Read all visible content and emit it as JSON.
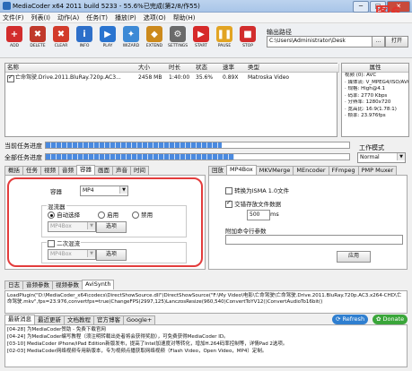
{
  "window": {
    "title": "MediaCoder x64 2011 build 5233 - 55.6%已完成(第2/8/作55)",
    "min": "─",
    "max": "□",
    "close": "✕"
  },
  "annotation": "图6",
  "menu": [
    "文件(F)",
    "列表(I)",
    "动作(A)",
    "任务(T)",
    "播放(P)",
    "选项(O)",
    "帮助(H)"
  ],
  "toolbar": {
    "buttons": [
      {
        "label": "ADD",
        "icon": "add-icon",
        "color": "#d22d2d",
        "glyph": "+"
      },
      {
        "label": "DELETE",
        "icon": "delete-icon",
        "color": "#c0392b",
        "glyph": "✖"
      },
      {
        "label": "CLEAR",
        "icon": "clear-icon",
        "color": "#d23b2b",
        "glyph": "✖"
      },
      {
        "label": "INFO",
        "icon": "info-icon",
        "color": "#2d6fc9",
        "glyph": "i"
      },
      {
        "label": "PLAY",
        "icon": "play-icon",
        "color": "#2a74d0",
        "glyph": "▶"
      },
      {
        "label": "WIZARD",
        "icon": "wizard-icon",
        "color": "#3d8ad6",
        "glyph": "✦"
      },
      {
        "label": "EXTEND",
        "icon": "extend-icon",
        "color": "#cc8a1d",
        "glyph": "◆"
      },
      {
        "label": "SETTINGS",
        "icon": "settings-icon",
        "color": "#6a6a6a",
        "glyph": "⚙"
      },
      {
        "label": "START",
        "icon": "start-icon",
        "color": "#d62a2a",
        "glyph": "▶"
      },
      {
        "label": "PAUSE",
        "icon": "pause-icon",
        "color": "#e2a423",
        "glyph": "❚❚"
      },
      {
        "label": "STOP",
        "icon": "stop-icon",
        "color": "#d22d2d",
        "glyph": "■"
      }
    ],
    "output_label": "输出路径",
    "output_path": "C:\\Users\\Administrator\\Desk",
    "browse": "...",
    "open": "打开"
  },
  "filelist": {
    "columns": [
      "名称",
      "大小",
      "时长",
      "状态",
      "速率",
      "类型"
    ],
    "rows": [
      {
        "name": "亡命驾驶.Drive.2011.BluRay.720p.AC3...",
        "size": "2458 MB",
        "duration": "1:40:00",
        "status": "35.6%",
        "rate": "0.89X",
        "type": "Matroska Video"
      }
    ]
  },
  "properties": {
    "header": "属性",
    "items": [
      "视频 (0): AVC",
      "· 媒体流: V_MPEG4/ISO/AVC",
      "· 规格: High@4.1",
      "· 码率: 2770 Kbps",
      "· 分辨率: 1280x720",
      "· 宽高比: 16:9(1.78:1)",
      "· 帧率: 23.976fps"
    ]
  },
  "progress": {
    "current_label": "当前任务进度",
    "total_label": "全部任务进度",
    "current": 0.58,
    "total": 0.62
  },
  "workmode": {
    "label": "工作模式",
    "value": "Normal"
  },
  "left_tabs": [
    "概括",
    "任务",
    "视频",
    "音频",
    "容器",
    "画面",
    "声音",
    "时间"
  ],
  "right_tabs": [
    "回放",
    "MP4Box",
    "MKVMerge",
    "MEncoder",
    "FFmpeg",
    "PMP Muxer"
  ],
  "container": {
    "label": "容器",
    "value": "MP4",
    "muxer_group": "混流器",
    "auto": "自动选择",
    "enable": "启用",
    "disable": "禁用",
    "muxer_value": "MP4Box",
    "muxer_btn": "选项",
    "second_pass": "二次混流",
    "second_value": "MP4Box",
    "second_btn": "选项"
  },
  "mp4box": {
    "ipsa": "转换为ISMA 1.0文件",
    "interleave": "交错存放文件数据",
    "interleave_value": "500",
    "interleave_unit": "ms",
    "extra_label": "附加命令行参数",
    "apply": "应用"
  },
  "bottom_tabs": [
    "日志",
    "音频参数",
    "视频参数",
    "AviSynth"
  ],
  "log": "LoadPlugin(\"D:\\MediaCoder_x64\\codecs\\DirectShowSource.dll\")DirectShowSource(\"F:\\My Video\\电影\\亡命驾驶\\亡命驾驶.Drive.2011.BluRay.720p.AC3.x264-CHD\\亡命驾驶.mkv\",fps=23.976,convertfps=true)ChangeFPS(2997,125)LanczosResize(960,540)ConvertToYV12()ConvertAudioTo16bit()",
  "news_tabs": [
    "最新消息",
    "最近更新",
    "文档教程",
    "官方博客",
    "Google+"
  ],
  "refresh": "Refresh",
  "donate": "Donate",
  "news": [
    "[04-28] 为MediaCoder赞助 - 免费下载官网",
    "[04-24] 为MediaCoder编写教程（须注明转载出处者将会获得奖励），可免费获得MediaCoder ID。",
    "[03-10] MediaCoder iPhone/iPad Edition新版发布，提高了Intel加速度对等转化，增加H.264码率控制等，详情Pad 2选项。",
    "[02-03] MediaCoder网络视频专用新版本，专为视频点播获取网络视频（Flash Video，Open Video，MP4）定制。"
  ]
}
